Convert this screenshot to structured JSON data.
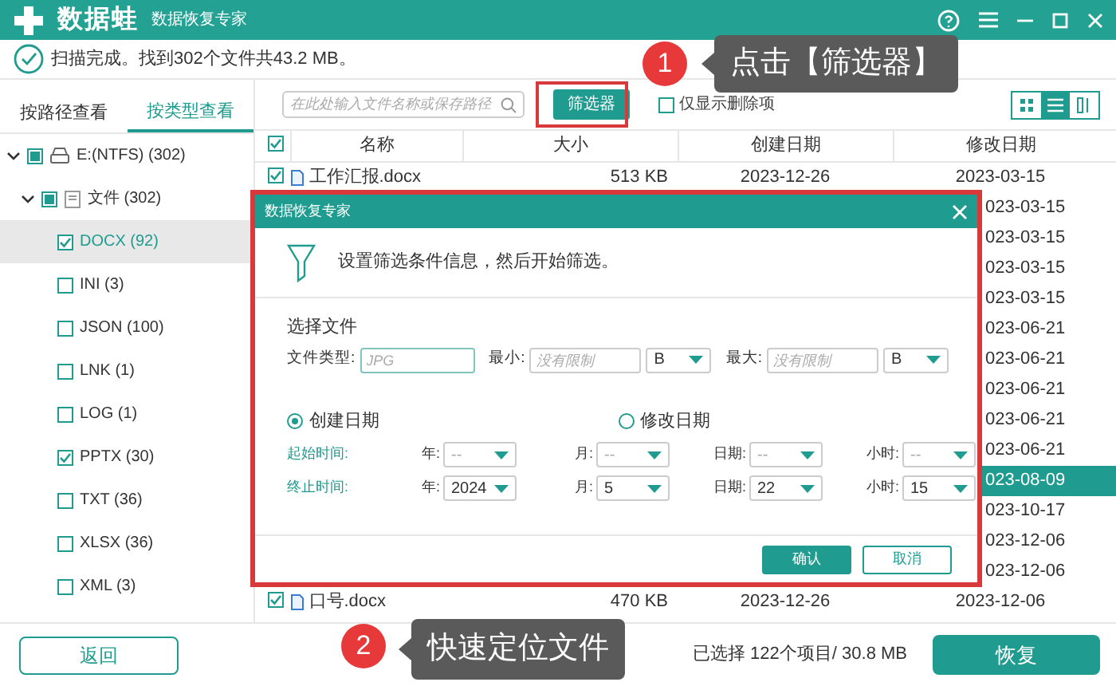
{
  "app": {
    "logo": "数据蛙",
    "subtitle": "数据恢复专家"
  },
  "status": "扫描完成。找到302个文件共43.2 MB。",
  "view_tabs": [
    {
      "label": "按路径查看",
      "selected": false
    },
    {
      "label": "按类型查看",
      "selected": true
    }
  ],
  "tree": [
    {
      "label": "E:(NTFS) (302)",
      "kind": "drive",
      "partial": true,
      "expanded": true,
      "children": [
        {
          "label": "文件 (302)",
          "kind": "folder",
          "partial": true,
          "expanded": true,
          "children": [
            {
              "label": "DOCX (92)",
              "kind": "type",
              "checked": true,
              "selected": true
            },
            {
              "label": "INI (3)",
              "kind": "type",
              "checked": false,
              "selected": false
            },
            {
              "label": "JSON (100)",
              "kind": "type",
              "checked": false,
              "selected": false
            },
            {
              "label": "LNK (1)",
              "kind": "type",
              "checked": false,
              "selected": false
            },
            {
              "label": "LOG (1)",
              "kind": "type",
              "checked": false,
              "selected": false
            },
            {
              "label": "PPTX (30)",
              "kind": "type",
              "checked": true,
              "selected": false
            },
            {
              "label": "TXT (36)",
              "kind": "type",
              "checked": false,
              "selected": false
            },
            {
              "label": "XLSX (36)",
              "kind": "type",
              "checked": false,
              "selected": false
            },
            {
              "label": "XML (3)",
              "kind": "type",
              "checked": false,
              "selected": false
            }
          ]
        }
      ]
    }
  ],
  "search": {
    "placeholder": "在此处输入文件名称或保存路径"
  },
  "filter_button": "筛选器",
  "deleted_only": {
    "label": "仅显示删除项",
    "checked": false
  },
  "view_modes": [
    {
      "kind": "grid",
      "selected": false
    },
    {
      "kind": "list",
      "selected": true
    },
    {
      "kind": "detail",
      "selected": false
    }
  ],
  "table": {
    "header_checked": true,
    "columns": [
      "名称",
      "大小",
      "创建日期",
      "修改日期"
    ],
    "rows": [
      {
        "name": "工作汇报.docx",
        "size": "513 KB",
        "created": "2023-12-26",
        "modified": "2023-03-15",
        "checked": true,
        "selected": false
      },
      {
        "modified": "023-03-15",
        "selected": false
      },
      {
        "modified": "023-03-15",
        "selected": false
      },
      {
        "modified": "023-03-15",
        "selected": false
      },
      {
        "modified": "023-03-15",
        "selected": false
      },
      {
        "modified": "023-06-21",
        "selected": false
      },
      {
        "modified": "023-06-21",
        "selected": false
      },
      {
        "modified": "023-06-21",
        "selected": false
      },
      {
        "modified": "023-06-21",
        "selected": false
      },
      {
        "modified": "023-06-21",
        "selected": false
      },
      {
        "modified": "023-08-09",
        "selected": true
      },
      {
        "modified": "023-10-17",
        "selected": false
      },
      {
        "modified": "023-12-06",
        "selected": false
      },
      {
        "modified": "023-12-06",
        "selected": false
      },
      {
        "name": "口号.docx",
        "size": "470 KB",
        "created": "2023-12-26",
        "modified": "2023-12-06",
        "checked": true,
        "selected": false
      }
    ]
  },
  "back_button": "返回",
  "selection_summary": "已选择 122个项目/ 30.8 MB",
  "recover_button": "恢复",
  "dialog": {
    "title": "数据恢复专家",
    "intro": "设置筛选条件信息，然后开始筛选。",
    "section": "选择文件",
    "type_label": "文件类型:",
    "type_placeholder": "JPG",
    "min_label": "最小:",
    "min_placeholder": "没有限制",
    "min_unit": "B",
    "max_label": "最大:",
    "max_placeholder": "没有限制",
    "max_unit": "B",
    "date_modes": [
      {
        "label": "创建日期",
        "selected": true
      },
      {
        "label": "修改日期",
        "selected": false
      }
    ],
    "time_rows": [
      {
        "label": "起始时间:",
        "fields": [
          {
            "label": "年:",
            "placeholder": "--"
          },
          {
            "label": "月:",
            "placeholder": "--"
          },
          {
            "label": "日期:",
            "placeholder": "--"
          },
          {
            "label": "小时:",
            "placeholder": "--"
          }
        ]
      },
      {
        "label": "终止时间:",
        "fields": [
          {
            "label": "年:",
            "value": "2024"
          },
          {
            "label": "月:",
            "value": "5"
          },
          {
            "label": "日期:",
            "value": "22"
          },
          {
            "label": "小时:",
            "value": "15"
          }
        ]
      }
    ],
    "buttons": [
      {
        "label": "确认",
        "kind": "primary"
      },
      {
        "label": "取消",
        "kind": "secondary"
      }
    ]
  },
  "annotations": [
    {
      "number": "1",
      "text": "点击【筛选器】"
    },
    {
      "number": "2",
      "text": "快速定位文件"
    }
  ]
}
